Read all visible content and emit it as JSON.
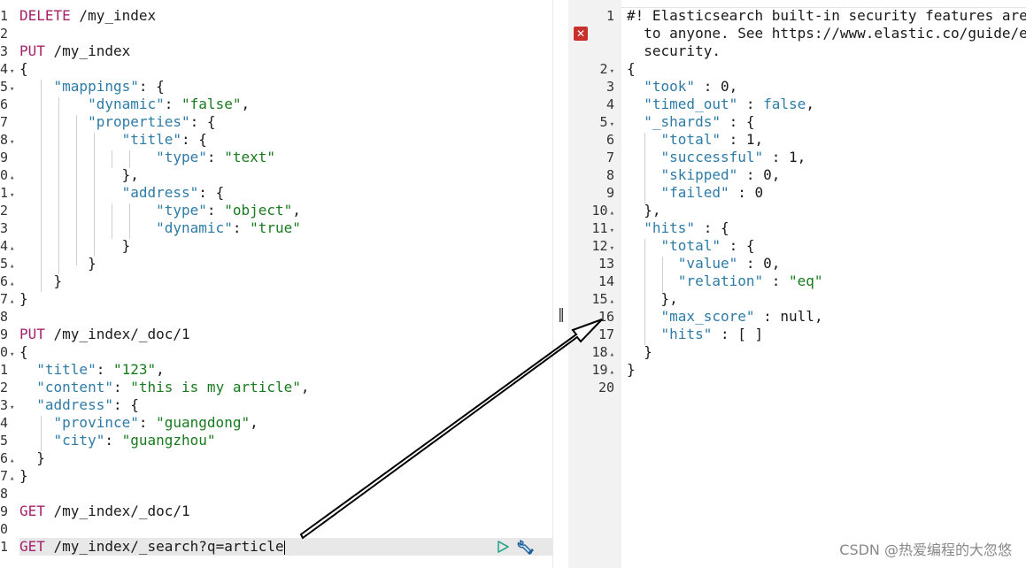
{
  "left_gutter": [
    "1",
    "2",
    "3",
    "4",
    "5",
    "6",
    "7",
    "8",
    "9",
    "0",
    "1",
    "2",
    "3",
    "4",
    "5",
    "6",
    "7",
    "8",
    "9",
    "0",
    "1",
    "2",
    "3",
    "4",
    "5",
    "6",
    "7",
    "8",
    "9",
    "0",
    "1"
  ],
  "left_fold": [
    "",
    "",
    "",
    "▾",
    "▾",
    "",
    "",
    "▾",
    "",
    "▴",
    "▾",
    "",
    "",
    "▴",
    "▴",
    "▴",
    "▴",
    "",
    "",
    "▾",
    "",
    "",
    "▾",
    "",
    "",
    "▴",
    "▴",
    "",
    "",
    "",
    ""
  ],
  "left_code": {
    "l1": {
      "method": "DELETE",
      "path": " /my_index"
    },
    "l3": {
      "method": "PUT",
      "path": " /my_index"
    },
    "l4": "{",
    "l5": {
      "key": "\"mappings\"",
      "rest": ": {"
    },
    "l6": {
      "key": "\"dynamic\"",
      "sep": ": ",
      "val": "\"false\"",
      "end": ","
    },
    "l7": {
      "key": "\"properties\"",
      "rest": ": {"
    },
    "l8": {
      "key": "\"title\"",
      "rest": ": {"
    },
    "l9": {
      "key": "\"type\"",
      "sep": ": ",
      "val": "\"text\""
    },
    "l10": "},",
    "l11": {
      "key": "\"address\"",
      "rest": ": {"
    },
    "l12": {
      "key": "\"type\"",
      "sep": ": ",
      "val": "\"object\"",
      "end": ","
    },
    "l13": {
      "key": "\"dynamic\"",
      "sep": ": ",
      "val": "\"true\""
    },
    "l14": "}",
    "l15": "}",
    "l16": "}",
    "l17": "}",
    "l19": {
      "method": "PUT",
      "path": " /my_index/_doc/1"
    },
    "l20": "{",
    "l21": {
      "key": "\"title\"",
      "sep": ": ",
      "val": "\"123\"",
      "end": ","
    },
    "l22": {
      "key": "\"content\"",
      "sep": ": ",
      "val": "\"this is my article\"",
      "end": ","
    },
    "l23": {
      "key": "\"address\"",
      "rest": ": {"
    },
    "l24": {
      "key": "\"province\"",
      "sep": ": ",
      "val": "\"guangdong\"",
      "end": ","
    },
    "l25": {
      "key": "\"city\"",
      "sep": ": ",
      "val": "\"guangzhou\""
    },
    "l26": "}",
    "l27": "}",
    "l29": {
      "method": "GET",
      "path": " /my_index/_doc/1"
    },
    "l31": {
      "method": "GET",
      "path": " /my_index/_search?q=article"
    }
  },
  "right_gutter": [
    "1",
    "",
    "",
    "2",
    "3",
    "4",
    "5",
    "6",
    "7",
    "8",
    "9",
    "10",
    "11",
    "12",
    "13",
    "14",
    "15",
    "16",
    "17",
    "18",
    "19",
    "20"
  ],
  "right_fold": [
    "",
    "",
    "",
    "▾",
    "",
    "",
    "▾",
    "",
    "",
    "",
    "",
    "▴",
    "▾",
    "▾",
    "",
    "",
    "▴",
    "",
    "",
    "▴",
    "▴",
    ""
  ],
  "right_code": {
    "r1a": "#! Elasticsearch built-in security features are",
    "r1b": "to anyone. See https://www.elastic.co/guide/e",
    "r1c": "security.",
    "r2": "{",
    "r3": {
      "key": "\"took\"",
      "sep": " : ",
      "val": "0",
      "end": ","
    },
    "r4": {
      "key": "\"timed_out\"",
      "sep": " : ",
      "val": "false",
      "end": ","
    },
    "r5": {
      "key": "\"_shards\"",
      "rest": " : {"
    },
    "r6": {
      "key": "\"total\"",
      "sep": " : ",
      "val": "1",
      "end": ","
    },
    "r7": {
      "key": "\"successful\"",
      "sep": " : ",
      "val": "1",
      "end": ","
    },
    "r8": {
      "key": "\"skipped\"",
      "sep": " : ",
      "val": "0",
      "end": ","
    },
    "r9": {
      "key": "\"failed\"",
      "sep": " : ",
      "val": "0"
    },
    "r10": "},",
    "r11": {
      "key": "\"hits\"",
      "rest": " : {"
    },
    "r12": {
      "key": "\"total\"",
      "rest": " : {"
    },
    "r13": {
      "key": "\"value\"",
      "sep": " : ",
      "val": "0",
      "end": ","
    },
    "r14": {
      "key": "\"relation\"",
      "sep": " : ",
      "val": "\"eq\""
    },
    "r15": "},",
    "r16": {
      "key": "\"max_score\"",
      "sep": " : ",
      "val": "null",
      "end": ","
    },
    "r17": {
      "key": "\"hits\"",
      "rest": " : [ ]"
    },
    "r18": "}",
    "r19": "}"
  },
  "divider_handle": "‖",
  "error_icon": "✕",
  "icons": {
    "play": "play-icon",
    "wrench": "wrench-icon",
    "error": "error-icon",
    "fold": "fold-arrow-icon"
  },
  "colors": {
    "method": "#a6216b",
    "key": "#2e7ba6",
    "string": "#187a1e",
    "error": "#c9302c",
    "active_line": "#e8e8e8"
  },
  "watermark": "CSDN @热爱编程的大忽悠"
}
